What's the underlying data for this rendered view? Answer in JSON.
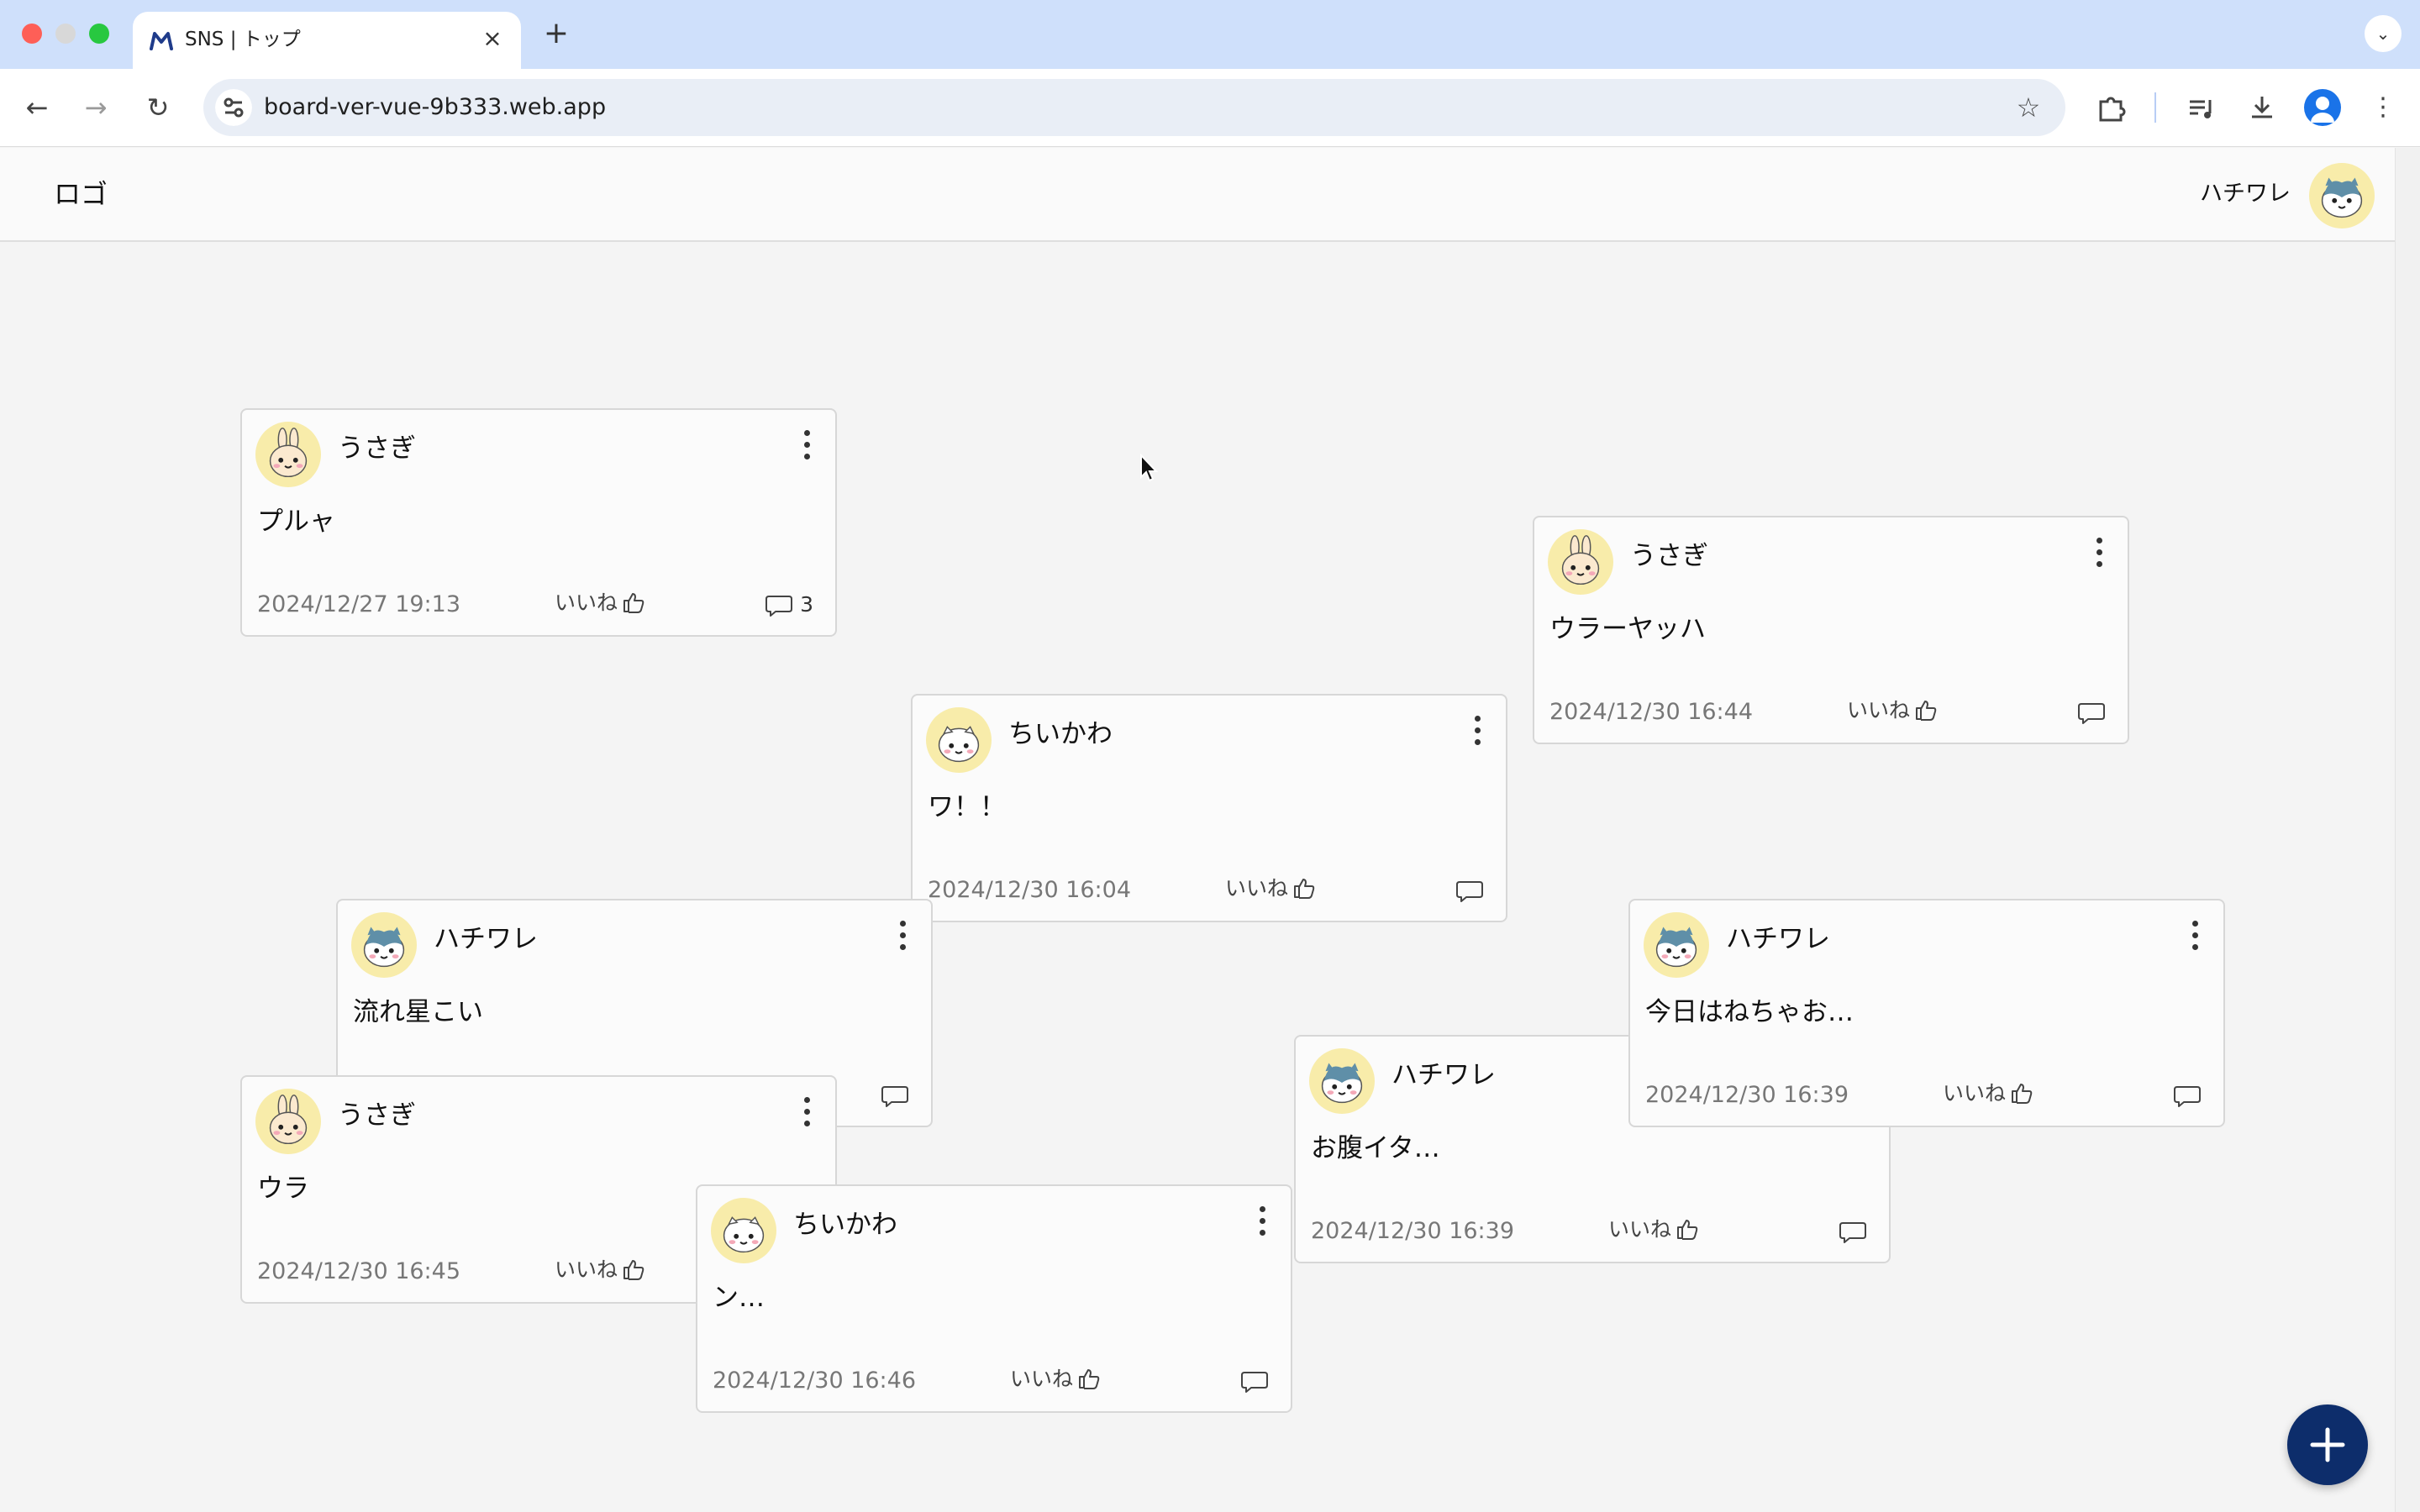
{
  "browser": {
    "tab_title": "SNS | トップ",
    "url": "board-ver-vue-9b333.web.app"
  },
  "header": {
    "logo": "ロゴ",
    "user_name": "ハチワレ"
  },
  "like_label": "いいね",
  "posts": [
    {
      "user": "うさぎ",
      "text": "プルャ",
      "date": "2024/12/27 19:13",
      "comments": "3"
    },
    {
      "user": "うさぎ",
      "text": "ウラーヤッハ",
      "date": "2024/12/30 16:44",
      "comments": ""
    },
    {
      "user": "ちいかわ",
      "text": "ワ！！",
      "date": "2024/12/30 16:04",
      "comments": ""
    },
    {
      "user": "ハチワレ",
      "text": "流れ星こい",
      "date": "",
      "comments": ""
    },
    {
      "user": "ハチワレ",
      "text": "今日はねちゃお…",
      "date": "2024/12/30 16:39",
      "comments": ""
    },
    {
      "user": "ハチワレ",
      "text": "お腹イタ…",
      "date": "2024/12/30 16:39",
      "comments": ""
    },
    {
      "user": "うさぎ",
      "text": "ウラ",
      "date": "2024/12/30 16:45",
      "comments": ""
    },
    {
      "user": "ちいかわ",
      "text": "ン…",
      "date": "2024/12/30 16:46",
      "comments": ""
    }
  ],
  "colors": {
    "tab_strip": "#cfe0fb",
    "fab": "#0d2d6b",
    "avatar_bg": "#f8ecaa",
    "card_bg": "#fbfbfb",
    "page_bg": "#f4f4f4"
  }
}
